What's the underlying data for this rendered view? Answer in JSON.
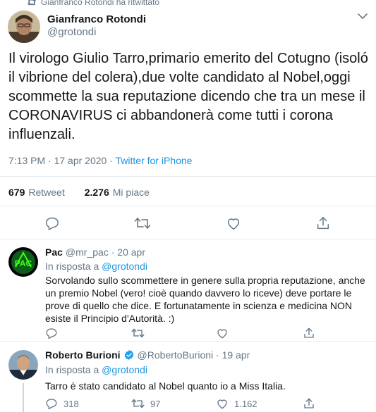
{
  "retweet_context": {
    "text": "Gianfranco Rotondi ha ritwittato",
    "icon": "retweet-icon"
  },
  "main_tweet": {
    "author_name": "Gianfranco Rotondi",
    "author_handle": "@grotondi",
    "text": "Il virologo Giulio Tarro,primario emerito del Cotugno (isoló il vibrione del colera),due volte candidato al Nobel,oggi scommette la sua reputazione dicendo che tra un mese il CORONAVIRUS ci abbandonerà come tutti i corona influenzali.",
    "time": "7:13 PM · 17 apr 2020 · ",
    "source": "Twitter for iPhone",
    "retweets_count": "679",
    "retweets_label": "Retweet",
    "likes_count": "2.276",
    "likes_label": "Mi piace",
    "icons": [
      "reply-icon",
      "retweet-icon",
      "like-icon",
      "share-icon",
      "chevron-down-icon"
    ]
  },
  "replies": [
    {
      "author_name": "Pac",
      "author_handle": "@mr_pac",
      "date": "20 apr",
      "reply_to_prefix": "In risposta a ",
      "reply_to_handle": "@grotondi",
      "text": "Sorvolando sullo scommettere in genere sulla propria reputazione, anche un premio Nobel (vero! cioè quando davvero lo riceve) deve portare le prove di quello che dice. E fortunatamente in scienza e medicina NON esiste il Principio d'Autorità. :)",
      "reply_count": "",
      "retweet_count": "",
      "like_count": ""
    },
    {
      "author_name": "Roberto Burioni",
      "author_handle": "@RobertoBurioni",
      "date": "19 apr",
      "verified": true,
      "reply_to_prefix": "In risposta a ",
      "reply_to_handle": "@grotondi",
      "text": "Tarro è stato candidato al Nobel quanto io a Miss Italia.",
      "reply_count": "318",
      "retweet_count": "97",
      "like_count": "1.162"
    }
  ],
  "colors": {
    "link": "#1b95e0",
    "muted": "#657786",
    "text": "#14171a",
    "divider": "#e6ecf0",
    "verified": "#1da1f2"
  }
}
